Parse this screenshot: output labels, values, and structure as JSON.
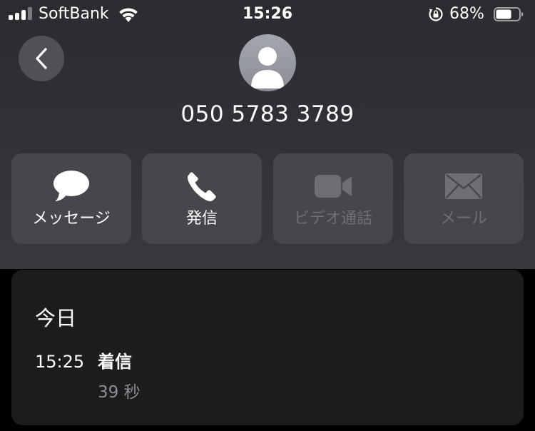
{
  "status_bar": {
    "carrier": "SoftBank",
    "time": "15:26",
    "battery_percent": "68%",
    "battery_level": 0.68,
    "signal_bars_filled": 3,
    "icons": [
      "signal-icon",
      "wifi-icon",
      "rotation-lock-icon",
      "battery-icon"
    ]
  },
  "contact": {
    "phone_number": "050 5783 3789",
    "avatar_icon": "person-silhouette-icon",
    "back_icon": "chevron-left-icon"
  },
  "actions": [
    {
      "label": "メッセージ",
      "icon": "message-bubble-icon",
      "enabled": true
    },
    {
      "label": "発信",
      "icon": "phone-icon",
      "enabled": true
    },
    {
      "label": "ビデオ通話",
      "icon": "video-camera-icon",
      "enabled": false
    },
    {
      "label": "メール",
      "icon": "envelope-icon",
      "enabled": false
    }
  ],
  "recents": {
    "day_heading": "今日",
    "calls": [
      {
        "time": "15:25",
        "type": "着信",
        "duration": "39 秒"
      }
    ]
  },
  "colors": {
    "button_bg": "#46474c",
    "disabled_text": "#6e6f74",
    "card_bg": "#1c1c1e",
    "secondary_text": "#8d8d93"
  }
}
